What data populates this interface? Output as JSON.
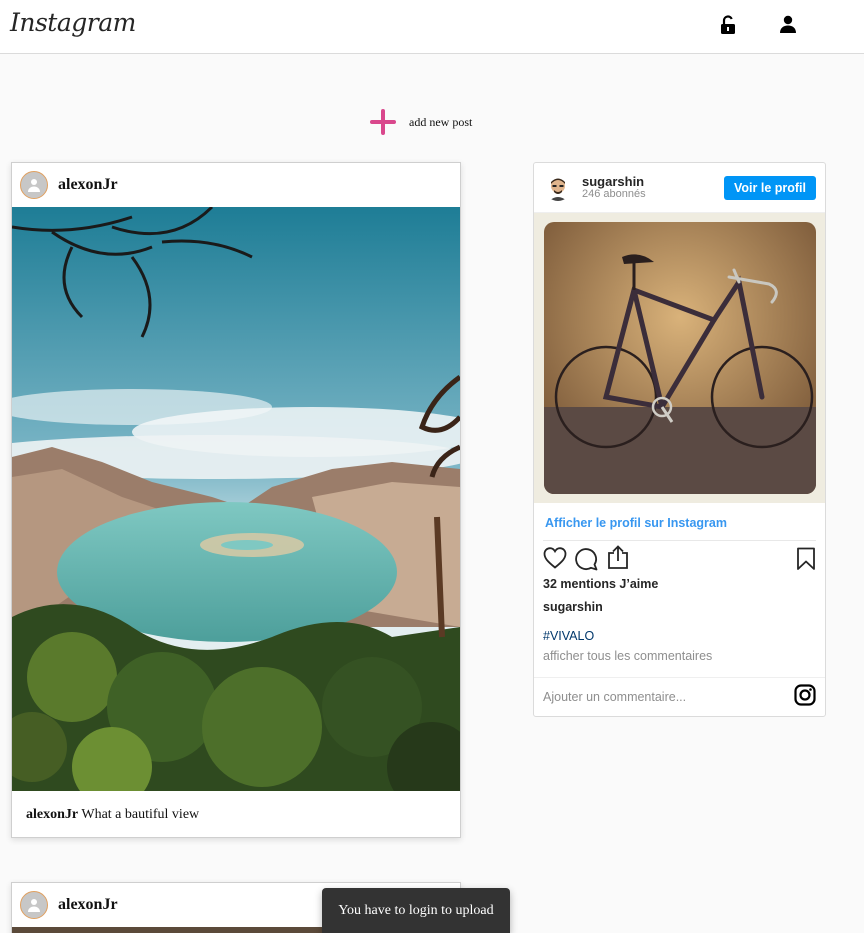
{
  "header": {
    "logo": "Instagram",
    "icons": [
      "unlock-icon",
      "user-icon"
    ]
  },
  "add_post": {
    "label": "add new post",
    "icon": "plus-icon",
    "icon_color": "#d9478c"
  },
  "posts": [
    {
      "username": "alexonJr",
      "caption_user": "alexonJr",
      "caption_text": "What a bautiful view"
    },
    {
      "username": "alexonJr"
    }
  ],
  "embed": {
    "username": "sugarshin",
    "followers": "246 abonnés",
    "profile_button": "Voir le profil",
    "view_on_instagram": "Afficher le profil sur Instagram",
    "likes": "32 mentions J’aime",
    "owner": "sugarshin",
    "hashtag": "#VIVALO",
    "view_comments": "afficher tous les commentaires",
    "comment_placeholder": "Ajouter un commentaire...",
    "button_color": "#0095f6",
    "link_color": "#3897f0"
  },
  "toast": {
    "message": "You have to login to upload"
  }
}
